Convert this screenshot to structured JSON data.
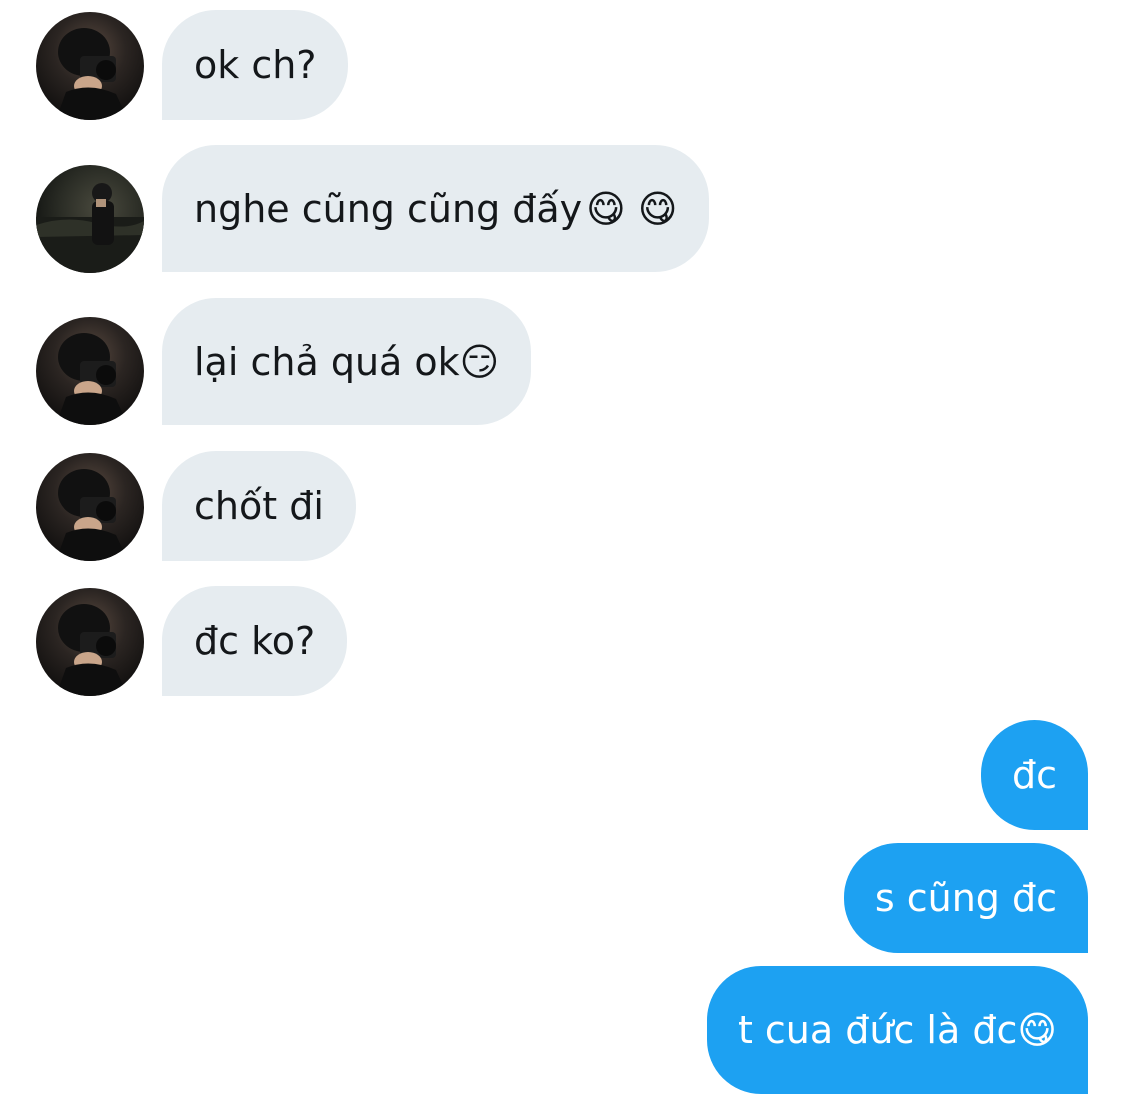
{
  "messages": [
    {
      "side": "in",
      "text": "ok ch?",
      "emoji": ""
    },
    {
      "side": "in",
      "text": "nghe cũng cũng đấy",
      "emoji": "😋 😋"
    },
    {
      "side": "in",
      "text": "lại chả quá ok",
      "emoji": "😏"
    },
    {
      "side": "in",
      "text": "chốt đi",
      "emoji": ""
    },
    {
      "side": "in",
      "text": "đc ko?",
      "emoji": ""
    },
    {
      "side": "out",
      "text": "đc",
      "emoji": ""
    },
    {
      "side": "out",
      "text": "s cũng đc",
      "emoji": ""
    },
    {
      "side": "out",
      "text": "t cua đức là đc",
      "emoji": "😋"
    }
  ],
  "colors": {
    "incoming_bubble": "#e6ecf0",
    "incoming_text": "#14171a",
    "outgoing_bubble": "#1da1f2",
    "outgoing_text": "#ffffff"
  },
  "icons": {
    "avatar": "user-avatar-photo"
  }
}
